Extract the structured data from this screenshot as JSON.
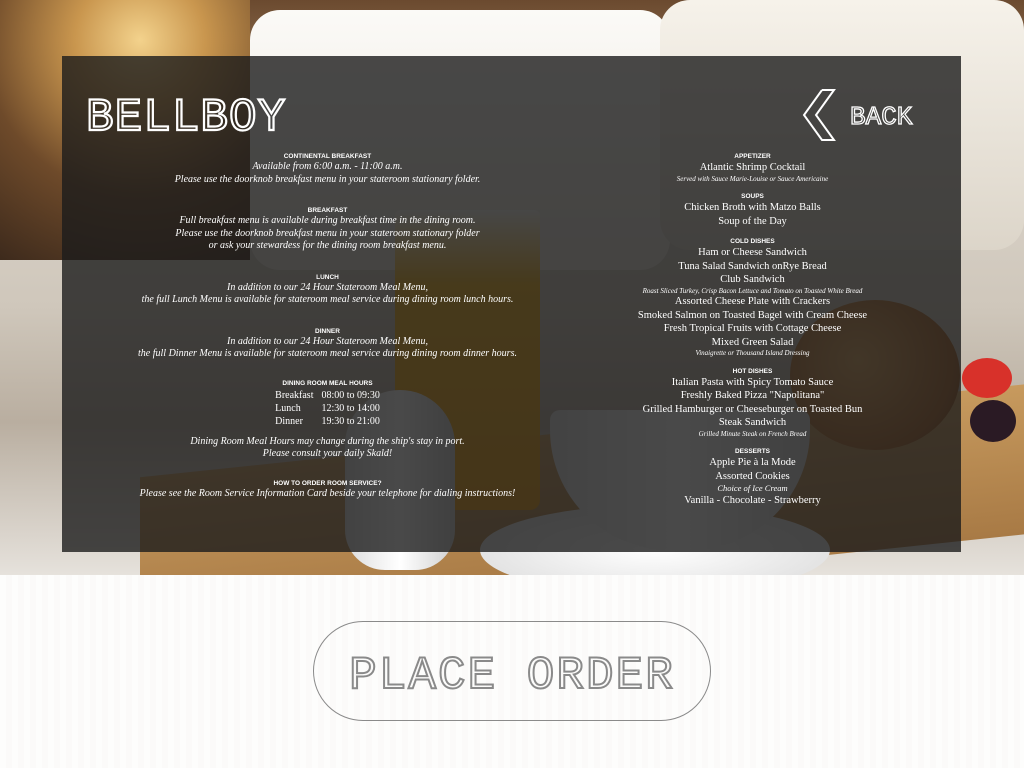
{
  "app": {
    "logo_text": "BELLBOY",
    "back_label": "BACK",
    "place_order_label": "PLACE ORDER"
  },
  "left": {
    "continental": {
      "head": "CONTINENTAL BREAKFAST",
      "lines": [
        "Available from 6:00 a.m. - 11:00 a.m.",
        "Please use the doorknob breakfast menu in your stateroom stationary folder."
      ]
    },
    "breakfast": {
      "head": "BREAKFAST",
      "lines": [
        "Full breakfast menu is available during breakfast time in the dining room.",
        "Please use the doorknob breakfast menu in your stateroom stationary folder",
        "or ask your stewardess for the dining room breakfast menu."
      ]
    },
    "lunch": {
      "head": "LUNCH",
      "lines": [
        "In addition to our 24 Hour Stateroom Meal Menu,",
        "the full Lunch Menu is available for stateroom meal service during dining room lunch hours."
      ]
    },
    "dinner": {
      "head": "DINNER",
      "lines": [
        "In addition to our 24 Hour Stateroom Meal Menu,",
        "the full Dinner Menu is available for stateroom meal service during dining room dinner hours."
      ]
    },
    "hours": {
      "head": "DINING ROOM MEAL HOURS",
      "rows": [
        {
          "meal": "Breakfast",
          "time": "08:00 to 09:30"
        },
        {
          "meal": "Lunch",
          "time": "12:30 to 14:00"
        },
        {
          "meal": "Dinner",
          "time": "19:30 to 21:00"
        }
      ],
      "notes": [
        "Dining Room Meal Hours may change during the ship's stay in port.",
        "Please consult your daily Skald!"
      ]
    },
    "order": {
      "head": "HOW TO ORDER ROOM SERVICE?",
      "line": "Please see the Room Service Information Card beside your telephone for dialing instructions!"
    }
  },
  "right": {
    "appetizer": {
      "head": "APPETIZER",
      "item": "Atlantic Shrimp Cocktail",
      "note": "Served with Sauce Marie-Louise or Sauce Americaine"
    },
    "soups": {
      "head": "SOUPS",
      "items": [
        "Chicken Broth with Matzo Balls",
        "Soup of the Day"
      ]
    },
    "cold": {
      "head": "COLD DISHES",
      "item1": "Ham or Cheese Sandwich",
      "item2": "Tuna Salad Sandwich onRye Bread",
      "item3": "Club Sandwich",
      "note3": "Roast Sliced Turkey, Crisp Bacon Lettuce and Tomato on Toasted White Bread",
      "item4": "Assorted Cheese Plate with Crackers",
      "item5": "Smoked Salmon on Toasted Bagel with Cream Cheese",
      "item6": "Fresh Tropical Fruits with Cottage Cheese",
      "item7": "Mixed Green Salad",
      "note7": "Vinaigrette or Thousand Island Dressing"
    },
    "hot": {
      "head": "HOT DISHES",
      "item1": "Italian Pasta with Spicy Tomato Sauce",
      "item2": "Freshly Baked Pizza \"Napolitana\"",
      "item3": "Grilled Hamburger or Cheeseburger on Toasted Bun",
      "item4": "Steak Sandwich",
      "note4": "Grilled Minute Steak on French Bread"
    },
    "desserts": {
      "head": "DESSERTS",
      "item1": "Apple Pie à la Mode",
      "item2": "Assorted Cookies",
      "note3": "Choice of Ice Cream",
      "item3": "Vanilla - Chocolate - Strawberry"
    }
  }
}
